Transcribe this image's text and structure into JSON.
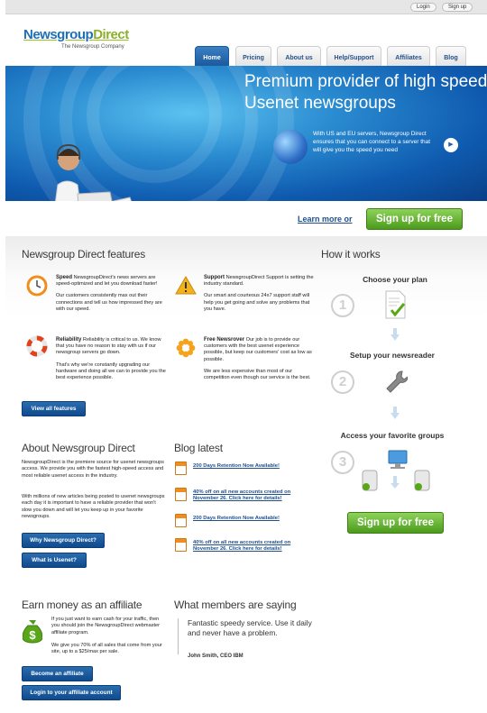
{
  "topbar": {
    "login": "Login",
    "signup": "Sign up"
  },
  "logo": {
    "name_part1": "Newsgroup",
    "name_part2": "Direct",
    "tagline": "The Newsgroup Company"
  },
  "nav": {
    "tabs": [
      "Home",
      "Pricing",
      "About us",
      "Help/Support",
      "Affiliates",
      "Blog"
    ],
    "active": "Home"
  },
  "hero": {
    "title": "Premium provider of high speed Usenet newsgroups",
    "text": "With US and EU servers, Newsgroup Direct ensures that you can connect to a server that will give you the speed you need"
  },
  "cta": {
    "learn_more": "Learn more or",
    "signup": "Sign up for free"
  },
  "features": {
    "heading": "Newsgroup Direct features",
    "items": [
      {
        "icon": "clock-icon",
        "title": "Speed",
        "text": "NewsgroupDirect's news servers are speed-optimized and let you download faster!",
        "text2": "Our customers consistently max out their connections and tell us how impressed they are with our speed."
      },
      {
        "icon": "warning-icon",
        "title": "Support",
        "text": "NewsgroupDirect Support is setting the industry standard.",
        "text2": "Our smart and courteous 24x7 support staff will help you get going and solve any problems that you have."
      },
      {
        "icon": "lifebuoy-icon",
        "title": "Reliability",
        "text": "Reliability is critical to us. We know that you have no reason to stay with us if our newsgroup servers go down.",
        "text2": "That's why we're constantly upgrading our hardware and doing all we can to provide you the best experience possible."
      },
      {
        "icon": "flower-icon",
        "title": "Free Newsrover",
        "text": "Our job is to provide our customers with the best usenet experience possible, but keep our customers' cost as low as possible.",
        "text2": "We are less expensive than most of our competition even though our service is the best."
      }
    ],
    "button": "View all features"
  },
  "about": {
    "heading": "About Newsgroup Direct",
    "text": "NewsgroupDirect is the premiere source for usenet newsgroups access. We provide you with the fastest high-speed access and most reliable usenet access in the industry.",
    "text2": "With millions of new articles being posted to usenet newsgroups each day it is important to have a reliable provider that won't slow you down and will let you keep up in your favorite newsgroups.",
    "button1": "Why Newsgroup Direct?",
    "button2": "What is Usenet?"
  },
  "blog": {
    "heading": "Blog latest",
    "items": [
      "200 Days Retention Now Available!",
      "40% off on all new accounts created on November 26. Click here for details!",
      "200 Days Retention Now Available!",
      "40% off on all new accounts created on November 26. Click here for details!"
    ]
  },
  "how": {
    "heading": "How it works",
    "steps": [
      {
        "num": "1",
        "label": "Choose your plan"
      },
      {
        "num": "2",
        "label": "Setup your newsreader"
      },
      {
        "num": "3",
        "label": "Access your favorite groups"
      }
    ],
    "signup": "Sign up for free"
  },
  "affiliate": {
    "heading": "Earn money as an affiliate",
    "text": "If you just want to earn cash for your traffic, then you should join the NewsgroupDirect webmaster affiliate program.",
    "text2": "We give you 70% of all sales that come from your site, up to a $25/max per sale.",
    "button1": "Become an affiliate",
    "button2": "Login to your affiliate account"
  },
  "testimonials": {
    "heading": "What members are saying",
    "quote": "Fantastic speedy service. Use it daily and never have a problem.",
    "author": "John Smith, CEO IBM"
  }
}
